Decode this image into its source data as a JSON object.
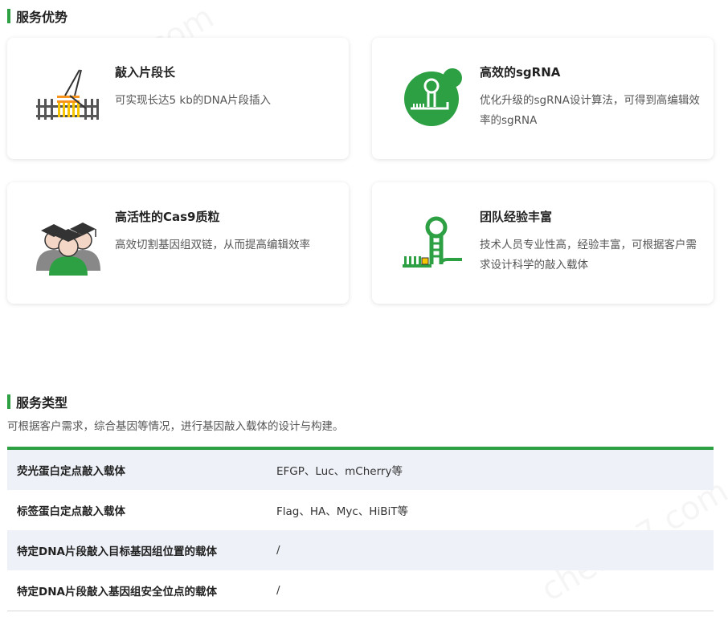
{
  "advantages": {
    "title": "服务优势",
    "cards": [
      {
        "title": "敲入片段长",
        "desc": "可实现长达5 kb的DNA片段插入",
        "icon": "dna-fragment-icon"
      },
      {
        "title": "高效的sgRNA",
        "desc": "优化升级的sgRNA设计算法，可得到高编辑效率的sgRNA",
        "icon": "sgrna-icon"
      },
      {
        "title": "高活性的Cas9质粒",
        "desc": "高效切割基因组双链，从而提高编辑效率",
        "icon": "experts-icon"
      },
      {
        "title": "团队经验丰富",
        "desc": "技术人员专业性高，经验丰富，可根据客户需求设计科学的敲入载体",
        "icon": "hairpin-icon"
      }
    ]
  },
  "services": {
    "title": "服务类型",
    "subtitle": "可根据客户需求，综合基因等情况，进行基因敲入载体的设计与构建。",
    "rows": [
      {
        "name": "荧光蛋白定点敲入载体",
        "value": "EFGP、Luc、mCherry等"
      },
      {
        "name": "标签蛋白定点敲入载体",
        "value": "Flag、HA、Myc、HiBiT等"
      },
      {
        "name": "特定DNA片段敲入目标基因组位置的载体",
        "value": "/"
      },
      {
        "name": "特定DNA片段敲入基因组安全位点的载体",
        "value": "/"
      }
    ]
  },
  "watermark": "chem17.com",
  "colors": {
    "accent": "#2ea044",
    "row_alt": "#eef2f8",
    "highlight": "#f7941d"
  }
}
